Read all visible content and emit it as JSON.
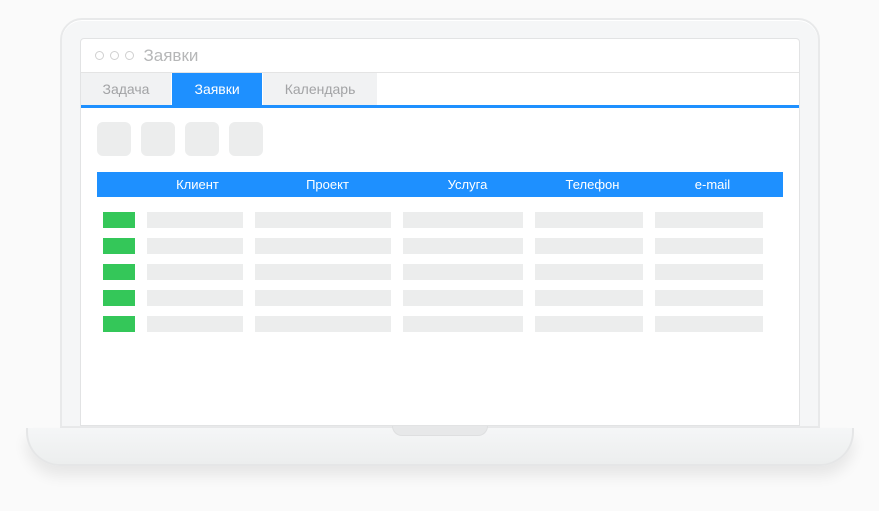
{
  "window": {
    "title": "Заявки"
  },
  "tabs": [
    {
      "label": "Задача",
      "active": false
    },
    {
      "label": "Заявки",
      "active": true
    },
    {
      "label": "Календарь",
      "active": false
    }
  ],
  "table": {
    "headers": {
      "client": "Клиент",
      "project": "Проект",
      "service": "Услуга",
      "phone": "Телефон",
      "email": "e-mail"
    },
    "row_count": 5
  },
  "colors": {
    "accent": "#1e90ff",
    "status_green": "#34c759",
    "placeholder": "#eceded"
  }
}
